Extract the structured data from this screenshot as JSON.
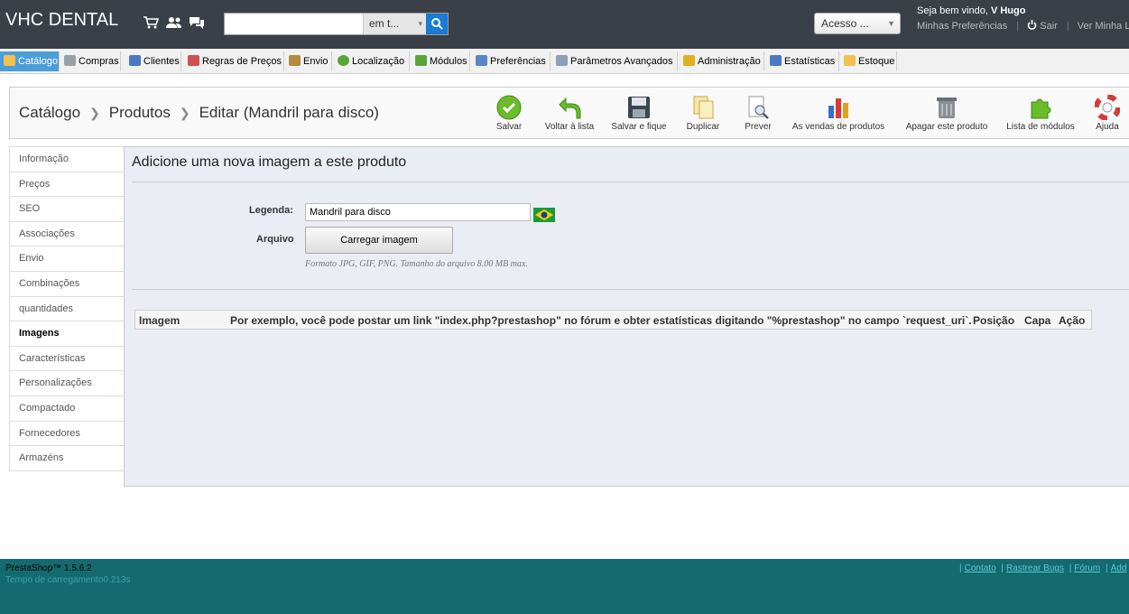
{
  "topbar": {
    "shop_name": "VHC DENTAL",
    "search": {
      "value": "",
      "type_label": "em t...",
      "caret": "▾"
    },
    "access_label": "Acesso ...",
    "welcome_prefix": "Seja bem vindo,",
    "user_name": "V Hugo",
    "links": [
      "Minhas Preferências",
      "Sair",
      "Ver Minha Lo"
    ]
  },
  "menu": [
    {
      "label": "Catálogo",
      "icon": "folder-icon",
      "color": "#f2c14e"
    },
    {
      "label": "Compras",
      "icon": "cart-icon",
      "color": "#9aa0a6"
    },
    {
      "label": "Clientes",
      "icon": "customers-icon",
      "color": "#4a78c2"
    },
    {
      "label": "Regras de Preços",
      "icon": "price-rules-icon",
      "color": "#d35050"
    },
    {
      "label": "Envio",
      "icon": "truck-icon",
      "color": "#b58a3c"
    },
    {
      "label": "Localização",
      "icon": "globe-icon",
      "color": "#5aa53a"
    },
    {
      "label": "Módulos",
      "icon": "puzzle-icon",
      "color": "#5aa53a"
    },
    {
      "label": "Preferências",
      "icon": "preferences-icon",
      "color": "#5a86c5"
    },
    {
      "label": "Parâmetros Avançados",
      "icon": "wrench-icon",
      "color": "#8aa0b8"
    },
    {
      "label": "Administração",
      "icon": "key-icon",
      "color": "#e0b020"
    },
    {
      "label": "Estatísticas",
      "icon": "stats-icon",
      "color": "#4a78c2"
    },
    {
      "label": "Estoque",
      "icon": "stock-icon",
      "color": "#f2c14e"
    }
  ],
  "breadcrumb": [
    "Catálogo",
    "Produtos",
    "Editar (Mandril para disco)"
  ],
  "toolbar": [
    {
      "label": "Salvar",
      "icon": "save-check-icon"
    },
    {
      "label": "Voltar à lista",
      "icon": "back-arrow-icon"
    },
    {
      "label": "Salvar e fique",
      "icon": "floppy-icon"
    },
    {
      "label": "Duplicar",
      "icon": "duplicate-icon"
    },
    {
      "label": "Prever",
      "icon": "preview-icon"
    },
    {
      "label": "As vendas de produtos",
      "icon": "sales-chart-icon"
    },
    {
      "label": "Apagar este produto",
      "icon": "trash-icon"
    },
    {
      "label": "Lista de módulos",
      "icon": "modules-puzzle-icon"
    },
    {
      "label": "Ajuda",
      "icon": "help-lifebuoy-icon"
    }
  ],
  "sidebar": [
    "Informação",
    "Preços",
    "SEO",
    "Associações",
    "Envio",
    "Combinações",
    "quantidades",
    "Imagens",
    "Características",
    "Personalizações",
    "Compactado",
    "Fornecedores",
    "Armazéns"
  ],
  "sidebar_active": "Imagens",
  "main": {
    "title": "Adicione uma nova imagem a este produto",
    "legend_label": "Legenda:",
    "legend_value": "Mandril para disco",
    "file_label": "Arquivo",
    "upload_button": "Carregar imagem",
    "format_note": "Formato JPG, GIF, PNG. Tamanho do arquivo 8.00 MB max.",
    "table_headers": [
      "Imagem",
      "Por exemplo, você pode postar um link \"index.php?prestashop\" no fórum e obter estatísticas digitando \"%prestashop\" no campo `request_uri`.",
      "Posição",
      "Capa",
      "Ação"
    ]
  },
  "footer": {
    "version": "PrestaShop™ 1.5.6.2",
    "load_time": "Tempo de carregamento0.213s",
    "links": [
      "Contato",
      "Rastrear Bugs",
      "Fórum",
      "Add"
    ]
  },
  "colors": {
    "accent": "#4b9ed9",
    "topbar": "#3a3f48",
    "footer": "#136b6f",
    "link": "#5cc6d6"
  }
}
